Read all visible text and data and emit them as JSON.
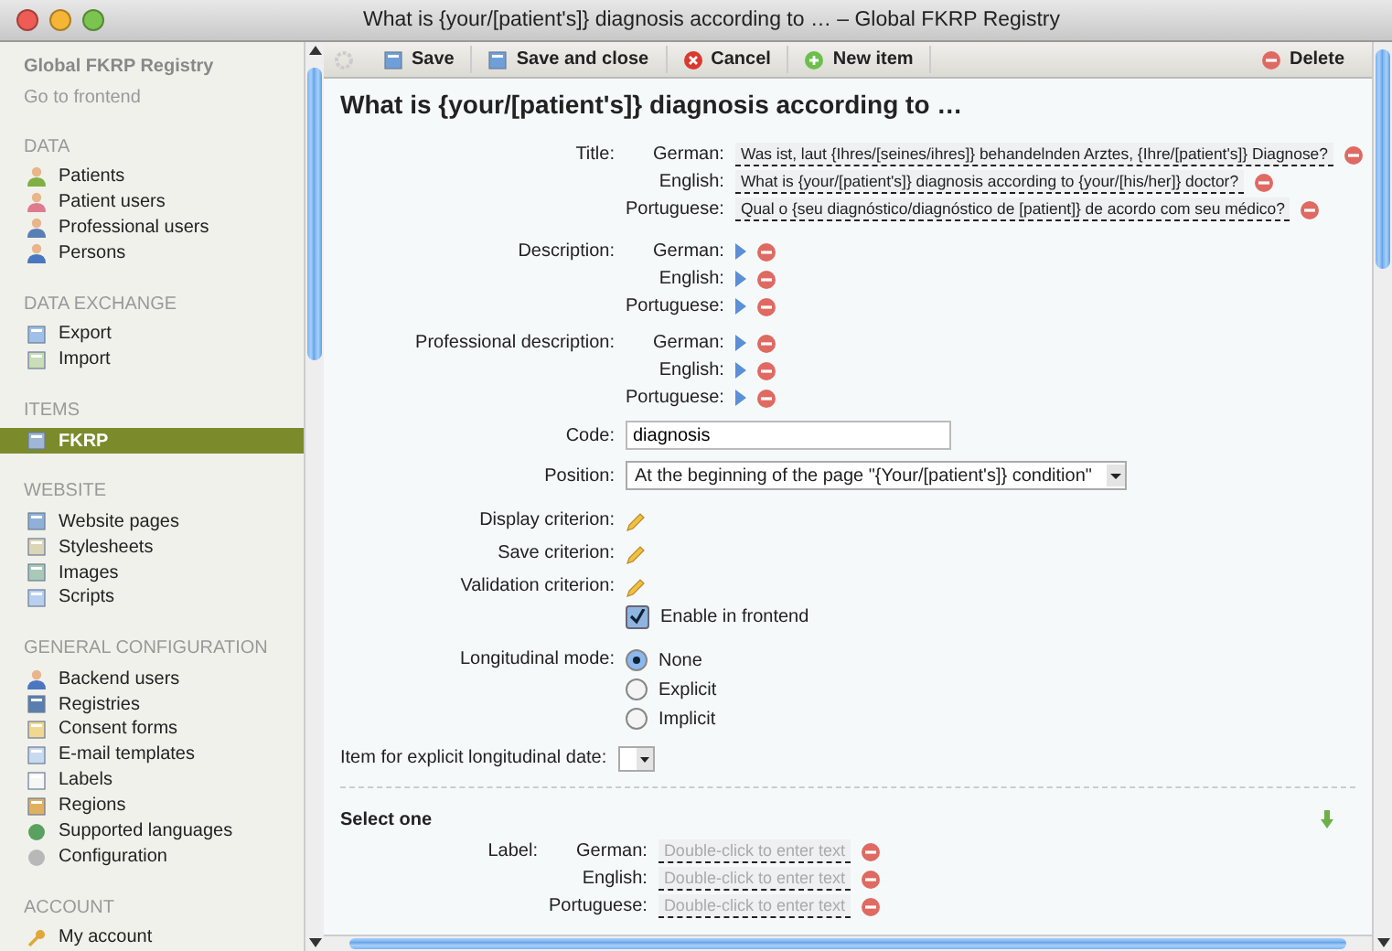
{
  "window": {
    "title": "What is {your/[patient's]} diagnosis according to … – Global FKRP Registry"
  },
  "sidebar": {
    "app_title": "Global FKRP Registry",
    "frontend_link": "Go to frontend",
    "sections": [
      {
        "heading": "DATA",
        "items": [
          {
            "label": "Patients",
            "selected": false
          },
          {
            "label": "Patient users",
            "selected": false
          },
          {
            "label": "Professional users",
            "selected": false
          },
          {
            "label": "Persons",
            "selected": false
          }
        ]
      },
      {
        "heading": "DATA EXCHANGE",
        "items": [
          {
            "label": "Export",
            "selected": false
          },
          {
            "label": "Import",
            "selected": false
          }
        ]
      },
      {
        "heading": "ITEMS",
        "items": [
          {
            "label": "FKRP",
            "selected": true
          }
        ]
      },
      {
        "heading": "WEBSITE",
        "items": [
          {
            "label": "Website pages",
            "selected": false
          },
          {
            "label": "Stylesheets",
            "selected": false
          },
          {
            "label": "Images",
            "selected": false
          },
          {
            "label": "Scripts",
            "selected": false
          }
        ]
      },
      {
        "heading": "GENERAL CONFIGURATION",
        "items": [
          {
            "label": "Backend users",
            "selected": false
          },
          {
            "label": "Registries",
            "selected": false
          },
          {
            "label": "Consent forms",
            "selected": false
          },
          {
            "label": "E-mail templates",
            "selected": false
          },
          {
            "label": "Labels",
            "selected": false
          },
          {
            "label": "Regions",
            "selected": false
          },
          {
            "label": "Supported languages",
            "selected": false
          },
          {
            "label": "Configuration",
            "selected": false
          }
        ]
      },
      {
        "heading": "ACCOUNT",
        "items": [
          {
            "label": "My account",
            "selected": false
          }
        ]
      }
    ]
  },
  "toolbar": {
    "left": [
      {
        "label": "Save",
        "disabled": false
      },
      {
        "label": "Save and close",
        "disabled": false
      },
      {
        "label": "Cancel",
        "disabled": false
      },
      {
        "label": "New item",
        "disabled": false
      }
    ],
    "right": [
      {
        "label": "Delete",
        "disabled": false
      }
    ]
  },
  "form": {
    "heading": "What is {your/[patient's]} diagnosis according to …",
    "title_field": {
      "label": "Title:",
      "translations": [
        {
          "language": "German:",
          "value": "Was ist, laut {Ihres/[seines/ihres]} behandelnden Arztes, {Ihre/[patient's]} Diagnose?"
        },
        {
          "language": "English:",
          "value": "What is {your/[patient's]} diagnosis according to {your/[his/her]} doctor?"
        },
        {
          "language": "Portuguese:",
          "value": "Qual o {seu diagnóstico/diagnóstico de [patient]} de acordo com seu médico?"
        }
      ]
    },
    "collapsed_fields": [
      {
        "label": "Description:",
        "languages": [
          "German:",
          "English:",
          "Portuguese:"
        ]
      },
      {
        "label": "Professional description:",
        "languages": [
          "German:",
          "English:",
          "Portuguese:"
        ]
      }
    ],
    "code": {
      "label": "Code:",
      "value": "diagnosis"
    },
    "position": {
      "label": "Position:",
      "value": "At the beginning of the page \"{Your/[patient's]} condition\""
    },
    "criteria": [
      {
        "label": "Display criterion:"
      },
      {
        "label": "Save criterion:"
      },
      {
        "label": "Validation criterion:"
      }
    ],
    "enable_frontend": {
      "label": "Enable in frontend",
      "checked": true
    },
    "longitudinal_mode": {
      "label": "Longitudinal mode:",
      "options": [
        {
          "label": "None",
          "selected": true
        },
        {
          "label": "Explicit",
          "selected": false
        },
        {
          "label": "Implicit",
          "selected": false
        }
      ]
    },
    "explicit_date": {
      "label": "Item for explicit longitudinal date:"
    },
    "select_one": {
      "heading": "Select one",
      "label": "Label:",
      "translations": [
        {
          "language": "German:",
          "placeholder": "Double-click to enter text"
        },
        {
          "language": "English:",
          "placeholder": "Double-click to enter text"
        },
        {
          "language": "Portuguese:",
          "placeholder": "Double-click to enter text"
        }
      ]
    }
  }
}
